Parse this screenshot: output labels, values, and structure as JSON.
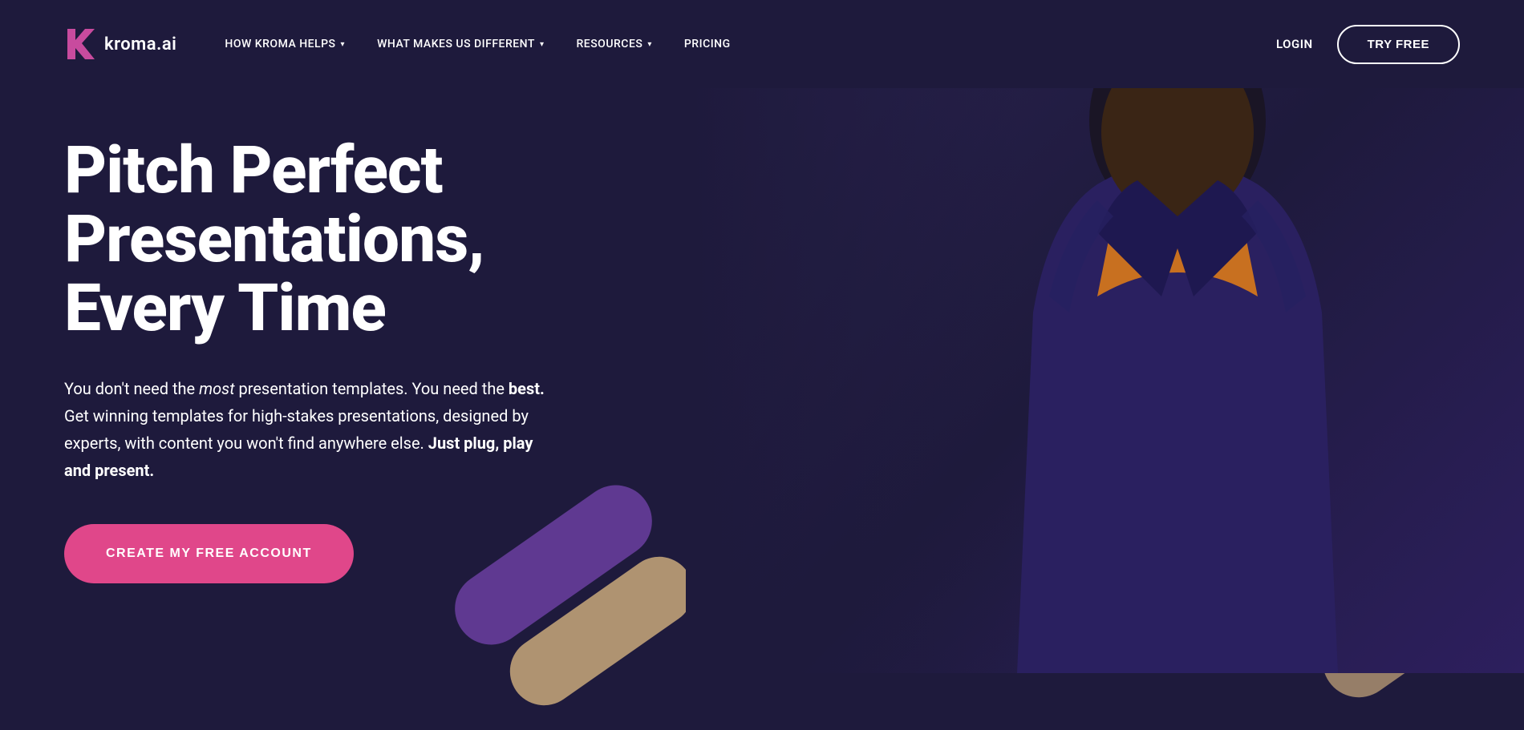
{
  "brand": {
    "logo_letter": "K",
    "logo_name": "kroma.ai"
  },
  "navbar": {
    "links": [
      {
        "label": "HOW KROMA HELPS",
        "has_dropdown": true
      },
      {
        "label": "WHAT MAKES US DIFFERENT",
        "has_dropdown": true
      },
      {
        "label": "RESOURCES",
        "has_dropdown": true
      },
      {
        "label": "PRICING",
        "has_dropdown": false
      }
    ],
    "login_label": "LOGIN",
    "try_free_label": "TRY FREE"
  },
  "hero": {
    "title_line1": "Pitch Perfect",
    "title_line2": "Presentations,",
    "title_line3": "Every Time",
    "subtitle_plain1": "You don't need the ",
    "subtitle_italic": "most",
    "subtitle_plain2": " presentation templates. You need the ",
    "subtitle_bold1": "best.",
    "subtitle_plain3": " Get winning templates for high-stakes presentations, designed by experts, with content you won't find anywhere else. ",
    "subtitle_bold2": "Just plug, play and present.",
    "cta_label": "CREATE MY FREE ACCOUNT"
  },
  "colors": {
    "background": "#1e1a3c",
    "accent_pink": "#e0478a",
    "accent_purple": "#6b3fa0",
    "accent_tan": "#c9a97a",
    "white": "#ffffff"
  }
}
